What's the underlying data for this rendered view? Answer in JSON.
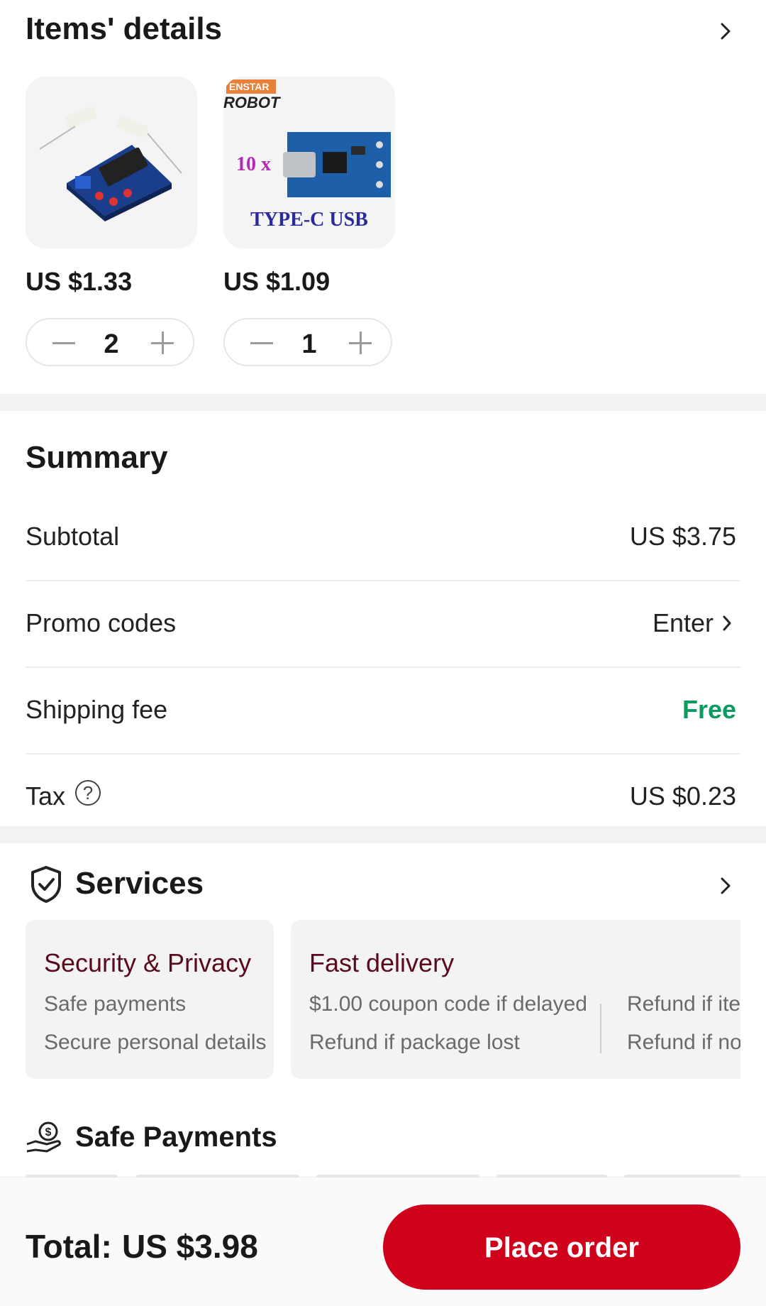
{
  "items_section": {
    "title": "Items' details",
    "items": [
      {
        "price": "US $1.33",
        "quantity": "2"
      },
      {
        "price": "US $1.09",
        "quantity": "1",
        "brand_text_1": "ENSTAR",
        "brand_text_2": "ROBOT",
        "badge_text": "10 x",
        "product_text": "TYPE-C USB"
      }
    ]
  },
  "summary": {
    "title": "Summary",
    "rows": [
      {
        "label": "Subtotal",
        "value": "US $3.75"
      },
      {
        "label": "Promo codes",
        "value": "Enter"
      },
      {
        "label": "Shipping fee",
        "value": "Free"
      },
      {
        "label": "Tax",
        "value": "US $0.23",
        "help_glyph": "?"
      }
    ]
  },
  "services": {
    "title": "Services",
    "cards": [
      {
        "title": "Security & Privacy",
        "lines": [
          "Safe payments",
          "Secure personal details"
        ]
      },
      {
        "title": "Fast delivery",
        "lines": [
          "$1.00 coupon code if delayed",
          "Refund if package lost"
        ],
        "lines_right": [
          "Refund if iter",
          "Refund if no"
        ]
      }
    ]
  },
  "safe_payments": {
    "title": "Safe Payments"
  },
  "bottom_bar": {
    "total_label": "Total:",
    "total_value": "US $3.98",
    "place_order_label": "Place order"
  },
  "colors": {
    "accent_red": "#d0021b",
    "free_green": "#0a9c5e",
    "service_title": "#5a0a1e",
    "band_gray": "#f2f2f2"
  },
  "icons": [
    "chevron-right-icon",
    "minus-icon",
    "plus-icon",
    "help-circle-icon",
    "shield-check-icon",
    "hand-coin-icon"
  ]
}
